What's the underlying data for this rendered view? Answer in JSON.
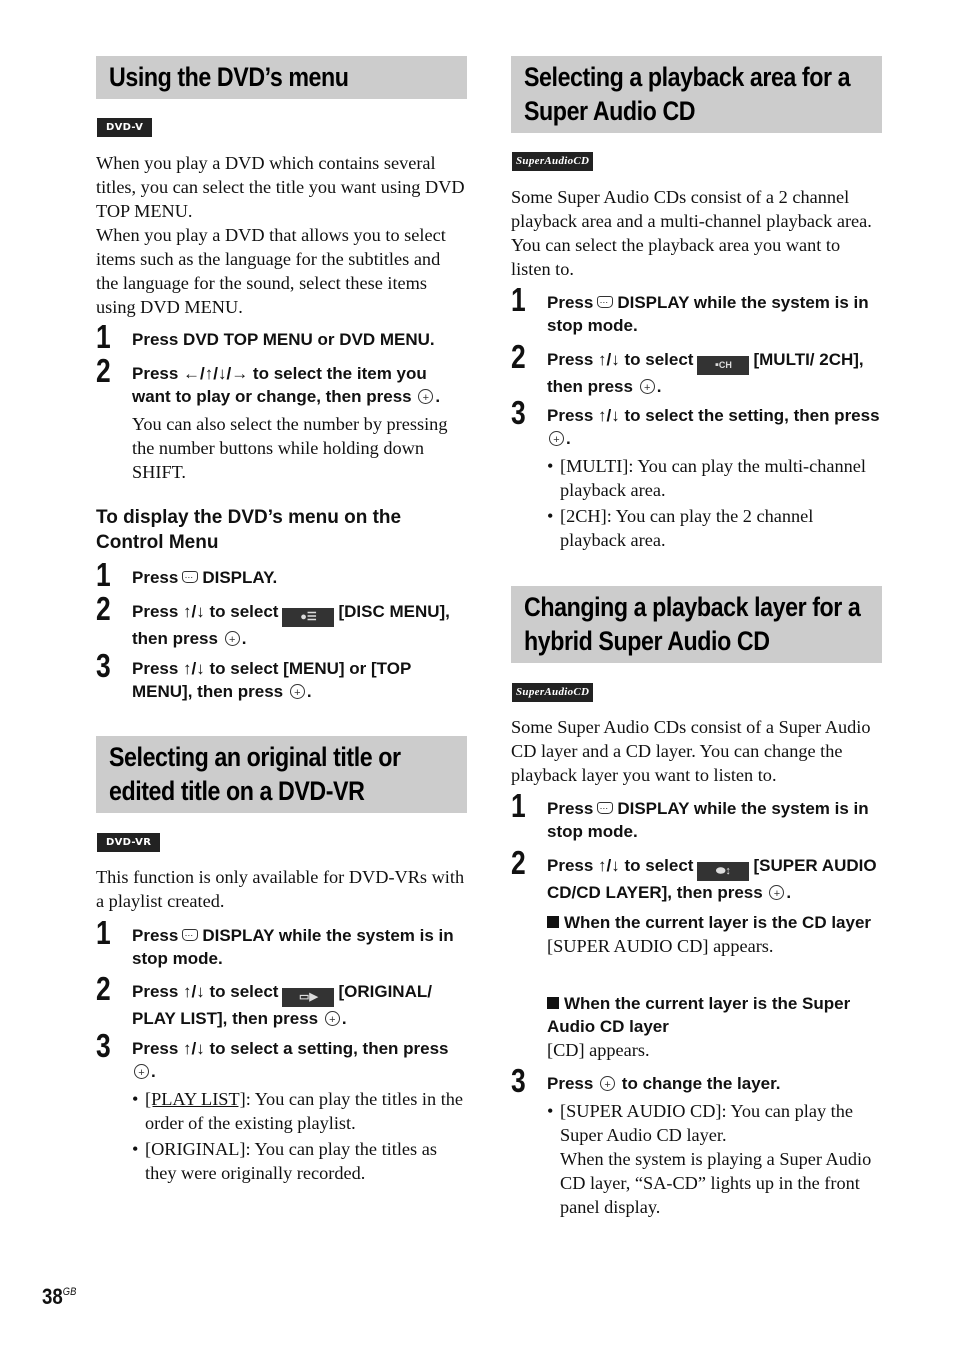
{
  "page": {
    "number": "38",
    "suffix": "GB"
  },
  "left": {
    "s1": {
      "title": "Using the DVD’s menu",
      "badge": "DVD-V",
      "intro": [
        "When you play a DVD which contains several titles, you can select the title you want using DVD TOP MENU.",
        "When you play a DVD that allows you to select items such as the language for the subtitles and the language for the sound, select these items using DVD MENU."
      ],
      "steps": [
        {
          "num": "1",
          "text": "Press DVD TOP MENU or DVD MENU."
        },
        {
          "num": "2",
          "text_a": "Press ←/↑/↓/→ to select the item you want to play or change, then press",
          "text_b": ".",
          "note": "You can also select the number by pressing the number buttons while holding down SHIFT."
        }
      ],
      "subhead": "To display the DVD’s menu on the Control Menu",
      "substeps": [
        {
          "num": "1",
          "text_a": "Press",
          "text_b": "DISPLAY."
        },
        {
          "num": "2",
          "text_a": "Press ↑/↓ to select",
          "text_b": "[DISC MENU], then press",
          "text_c": "."
        },
        {
          "num": "3",
          "text_a": "Press ↑/↓ to select [MENU] or [TOP MENU], then press",
          "text_b": "."
        }
      ]
    },
    "s2": {
      "title": "Selecting an original title or edited title on a DVD-VR",
      "badge": "DVD-VR",
      "intro": "This function is only available for DVD-VRs with a playlist created.",
      "steps": [
        {
          "num": "1",
          "text_a": "Press",
          "text_b": "DISPLAY while the system is in stop mode."
        },
        {
          "num": "2",
          "text_a": "Press ↑/↓ to select",
          "text_b": "[ORIGINAL/ PLAY LIST], then press",
          "text_c": "."
        },
        {
          "num": "3",
          "text_a": "Press ↑/↓ to select a setting, then press",
          "text_b": "."
        }
      ],
      "bullets": [
        {
          "term": "[PLAY LIST]",
          "text": ": You can play the titles in the order of the existing playlist."
        },
        {
          "term": "[ORIGINAL]",
          "text": ": You can play the titles as they were originally recorded."
        }
      ]
    }
  },
  "right": {
    "s3": {
      "title": "Selecting a playback area for a Super Audio CD",
      "badge": "SuperAudioCD",
      "intro": "Some Super Audio CDs consist of a 2 channel playback area and a multi-channel playback area. You can select the playback area you want to listen to.",
      "steps": [
        {
          "num": "1",
          "text_a": "Press",
          "text_b": "DISPLAY while the system is in stop mode."
        },
        {
          "num": "2",
          "text_a": "Press ↑/↓ to select",
          "text_b": "[MULTI/ 2CH], then press",
          "text_c": ".",
          "icon_label": "CH"
        },
        {
          "num": "3",
          "text_a": "Press ↑/↓ to select the setting, then press",
          "text_b": "."
        }
      ],
      "bullets": [
        "[MULTI]: You can play the multi-channel playback area.",
        "[2CH]: You can play the 2 channel playback area."
      ]
    },
    "s4": {
      "title": "Changing a playback layer for a hybrid Super Audio CD",
      "badge": "SuperAudioCD",
      "intro": "Some Super Audio CDs consist of a Super Audio CD layer and a CD layer. You can change the playback layer you want to listen to.",
      "steps": [
        {
          "num": "1",
          "text_a": "Press",
          "text_b": "DISPLAY while the system is in stop mode."
        },
        {
          "num": "2",
          "text_a": "Press ↑/↓ to select",
          "text_b": "[SUPER AUDIO CD/CD LAYER], then press",
          "text_c": "."
        },
        {
          "num": "3",
          "text_a": "Press",
          "text_b": "to change the layer."
        }
      ],
      "conditions": [
        {
          "head": "When the current layer is the CD layer",
          "text": "[SUPER AUDIO CD] appears."
        },
        {
          "head": "When the current layer is the Super Audio CD layer",
          "text": "[CD] appears."
        }
      ],
      "bullet": "[SUPER AUDIO CD]: You can play the Super Audio CD layer.",
      "bullet_note": "When the system is playing a Super Audio CD layer, “SA-CD” lights up in the front panel display."
    }
  }
}
